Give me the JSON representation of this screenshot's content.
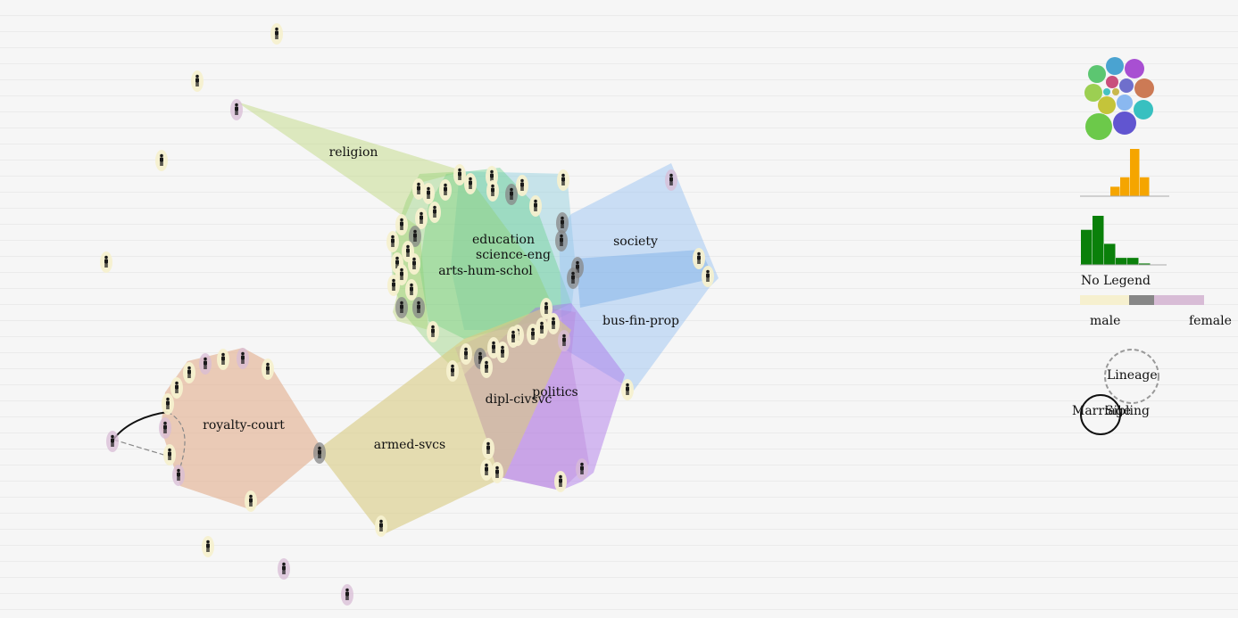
{
  "groups": [
    {
      "id": "religion",
      "label": "religion",
      "color": "#bcd77a"
    },
    {
      "id": "education",
      "label": "education",
      "color": "#7fc8d9"
    },
    {
      "id": "science_eng",
      "label": "science-eng",
      "color": "#5fcf86"
    },
    {
      "id": "arts_hum_schol",
      "label": "arts-hum-schol",
      "color": "#8fd070"
    },
    {
      "id": "society",
      "label": "society",
      "color": "#9cc4f2"
    },
    {
      "id": "bus_fin_prop",
      "label": "bus-fin-prop",
      "color": "#78aee6"
    },
    {
      "id": "politics",
      "label": "politics",
      "color": "#a86ee8"
    },
    {
      "id": "dipl_civsvc",
      "label": "dipl-civsvc",
      "color": "#b67fd8"
    },
    {
      "id": "armed_svcs",
      "label": "armed-svcs",
      "color": "#d9cb82"
    },
    {
      "id": "royalty_court",
      "label": "royalty-court",
      "color": "#e2ad8c"
    }
  ],
  "legend": {
    "no_legend_label": "No Legend",
    "gender_male": "male",
    "gender_female": "female",
    "lineage_label": "Lineage",
    "marriage_label": "Marriage",
    "sibling_label": "Sibling",
    "gender_colors": {
      "male": "#f6f0cf",
      "unknown": "#878787",
      "female": "#d8bcd6"
    },
    "bubble_colors": [
      "#5cc671",
      "#4aa3d1",
      "#a84fd2",
      "#c94f7c",
      "#6f6fcc",
      "#cc7a55",
      "#9ccf52",
      "#45c2c2",
      "#c9b84c",
      "#8ab8f0",
      "#c4c43a",
      "#38c0c0",
      "#6cc94a",
      "#6155d0",
      "#e04fa0",
      "#5fc7a5"
    ],
    "histogram_orange": [
      0,
      1,
      2,
      5,
      2,
      0
    ],
    "histogram_green": [
      5,
      7,
      3,
      1,
      1,
      0.2
    ]
  }
}
